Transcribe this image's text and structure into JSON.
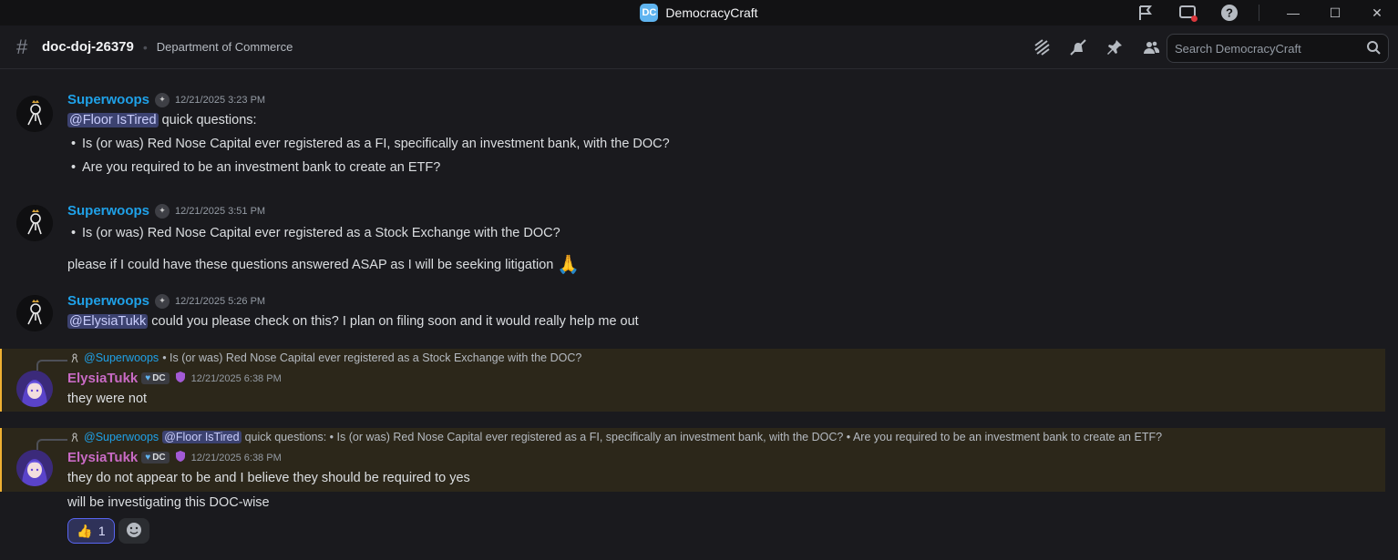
{
  "app": {
    "title": "DemocracyCraft",
    "logo_glyph": "DC"
  },
  "titlebar": {
    "icons": [
      "flag-icon",
      "screen-share-icon",
      "help-icon"
    ],
    "minimize": "—",
    "maximize": "☐",
    "close": "✕"
  },
  "header": {
    "hash": "#",
    "channel_name": "doc-doj-26379",
    "separator": "•",
    "topic": "Department of Commerce",
    "search_placeholder": "Search DemocracyCraft",
    "icons": [
      "threads-icon",
      "mute-notifications-icon",
      "pin-icon",
      "members-icon"
    ]
  },
  "messages": [
    {
      "author": "Superwoops",
      "timestamp": "12/21/2025 3:23 PM",
      "mention": "@Floor IsTired",
      "text": "quick questions:",
      "bullets": [
        "Is (or was) Red Nose Capital ever registered as a FI, specifically an investment bank, with the DOC?",
        "Are you required to be an investment bank to create an ETF?"
      ]
    },
    {
      "author": "Superwoops",
      "timestamp": "12/21/2025 3:51 PM",
      "bullets": [
        "Is (or was) Red Nose Capital ever registered as a Stock Exchange with the DOC?"
      ],
      "text": "please if I could have these questions answered ASAP as I will be seeking litigation",
      "emoji": "🙏"
    },
    {
      "author": "Superwoops",
      "timestamp": "12/21/2025 5:26 PM",
      "mention": "@ElysiaTukk",
      "text": "could you please check on this? I plan on filing soon and it would really help me out"
    },
    {
      "author": "ElysiaTukk",
      "timestamp": "12/21/2025 6:38 PM",
      "tag": "DC",
      "reply": {
        "name": "@Superwoops",
        "text": "• Is (or was) Red Nose Capital ever registered as a Stock Exchange with the DOC?"
      },
      "text": "they were not"
    },
    {
      "author": "ElysiaTukk",
      "timestamp": "12/21/2025 6:38 PM",
      "tag": "DC",
      "reply": {
        "name": "@Superwoops",
        "mention": "@Floor IsTired",
        "text": "quick questions: • Is (or was) Red Nose Capital ever registered as a FI, specifically an investment bank, with the DOC?  • Are you required to be an investment bank to create an ETF?"
      },
      "text": "they do not appear to be and I believe they should be required to yes",
      "text2": "will be investigating this DOC-wise",
      "reaction": {
        "emoji": "👍",
        "count": "1"
      }
    }
  ]
}
